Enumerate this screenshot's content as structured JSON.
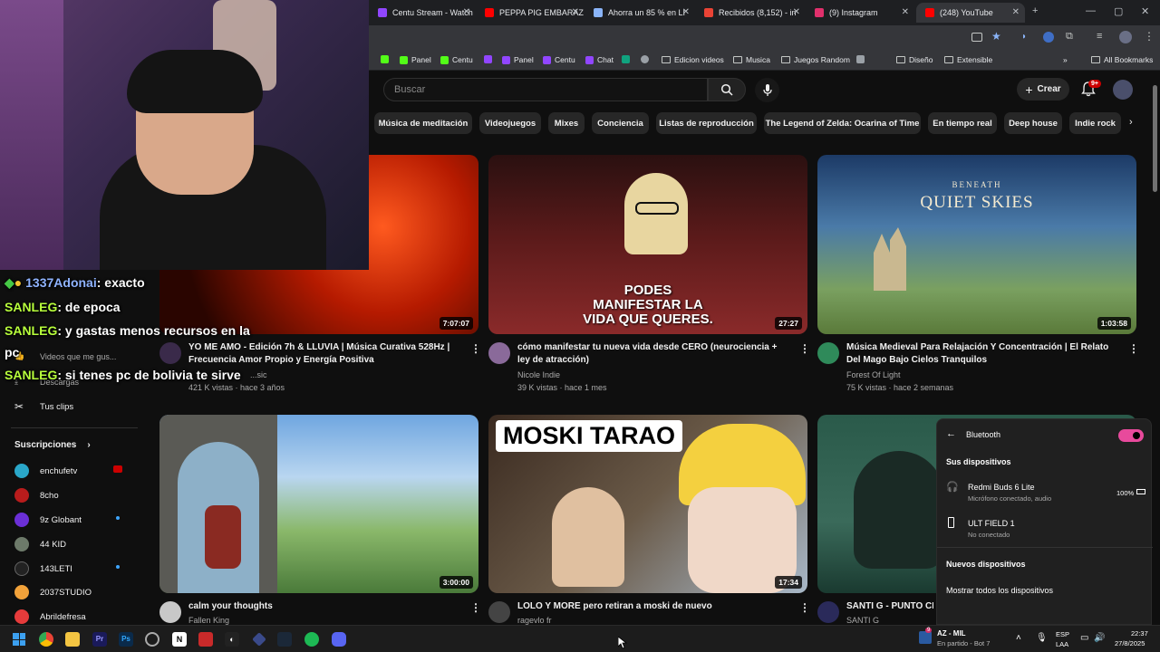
{
  "tabs": [
    {
      "title": "Centu Stream - Watch",
      "color": "#9146ff"
    },
    {
      "title": "PEPPA PIG EMBARAZ",
      "color": "#ff0000"
    },
    {
      "title": "Ahorra un 85 % en LI",
      "color": "#8ab4f8"
    },
    {
      "title": "Recibidos (8,152) - in",
      "color": "#ea4335"
    },
    {
      "title": "(9) Instagram",
      "color": "#e1306c"
    },
    {
      "title": "(248) YouTube",
      "color": "#ff0000"
    }
  ],
  "bookmarks": {
    "items": [
      "Panel",
      "Centu",
      "Panel",
      "Centu",
      "Chat",
      "Edicion videos",
      "Musica",
      "Juegos Random",
      "Diseño",
      "Extensible"
    ],
    "all_label": "All Bookmarks"
  },
  "header": {
    "search_placeholder": "Buscar",
    "create_label": "Crear",
    "notif_badge": "9+"
  },
  "chips": [
    "Música de meditación",
    "Videojuegos",
    "Mixes",
    "Conciencia",
    "Listas de reproducción",
    "The Legend of Zelda: Ocarina of Time",
    "En tiempo real",
    "Deep house",
    "Indie rock"
  ],
  "videos": [
    {
      "title": "YO ME AMO - Edición 7h & LLUVIA | Música Curativa 528Hz | Frecuencia Amor Propio y Energía Positiva",
      "channel": "...sic",
      "meta": "421 K vistas · hace 3 años",
      "duration": "7:07:07"
    },
    {
      "title": "cómo manifestar tu nueva vida desde CERO (neurociencia + ley de atracción)",
      "channel": "Nicole Indie",
      "meta": "39 K vistas · hace 1 mes",
      "duration": "27:27",
      "thumb_text": "PODES MANIFESTAR LA VIDA QUE QUERES."
    },
    {
      "title": "Música Medieval Para Relajación Y Concentración | El Relato Del Mago Bajo Cielos Tranquilos",
      "channel": "Forest Of Light",
      "meta": "75 K vistas · hace 2 semanas",
      "duration": "1:03:58",
      "thumb_small": "BENEATH",
      "thumb_big": "QUIET SKIES"
    },
    {
      "title": "calm your thoughts",
      "channel": "Fallen King",
      "duration": "3:00:00"
    },
    {
      "title": "LOLO Y MORE pero retiran a moski de nuevo",
      "channel": "ragevlo fr",
      "duration": "17:34",
      "thumb_text": "MOSKI TARAO"
    },
    {
      "title": "SANTI G - PUNTO CI",
      "channel": "SANTI G"
    }
  ],
  "sidebar": {
    "partial_item": "Videos que me gus...",
    "downloads": "Descargas",
    "clips": "Tus clips",
    "subs_title": "Suscripciones",
    "subs": [
      "enchufetv",
      "8cho",
      "9z Globant",
      "44 KID",
      "143LETI",
      "2037STUDIO",
      "Abrildefresa"
    ]
  },
  "chat": [
    {
      "user": "1337Adonai",
      "msg": ": exacto"
    },
    {
      "user": "SANLEG",
      "msg": ": de epoca"
    },
    {
      "user": "SANLEG",
      "msg": ": y gastas menos recursos en la"
    },
    {
      "user": "",
      "msg": "pc"
    },
    {
      "user": "SANLEG",
      "msg": ": si tenes pc de bolivia te sirve"
    }
  ],
  "bluetooth": {
    "title": "Bluetooth",
    "my_devices": "Sus dispositivos",
    "dev1_name": "Redmi Buds 6 Lite",
    "dev1_status": "Micrófono conectado, audio",
    "dev1_battery": "100%",
    "dev2_name": "ULT FIELD 1",
    "dev2_status": "No conectado",
    "new_devices": "Nuevos dispositivos",
    "show_all": "Mostrar todos los dispositivos"
  },
  "taskbar": {
    "game_badge": "9",
    "game_title": "AZ - MIL",
    "game_status": "En partido - Bot 7",
    "lang1": "ESP",
    "lang2": "LAA",
    "time": "22:37",
    "date": "27/8/2025"
  }
}
